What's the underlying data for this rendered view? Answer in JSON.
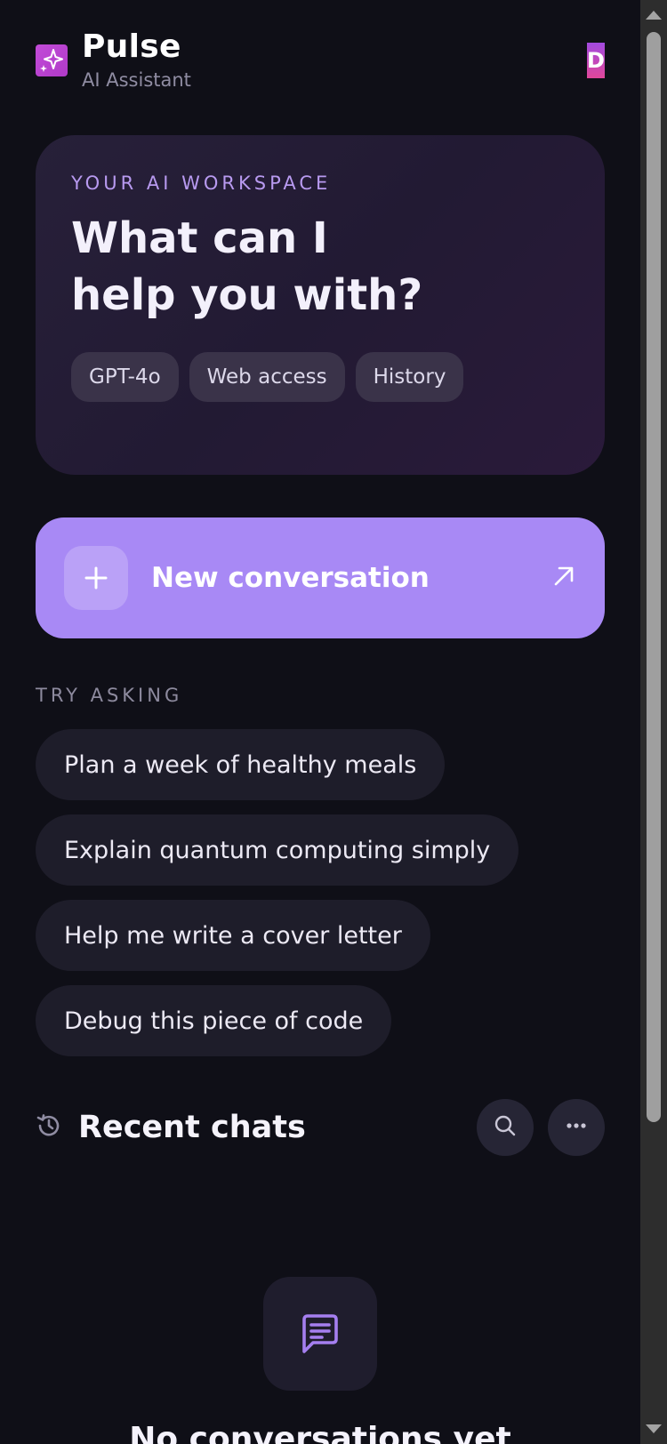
{
  "header": {
    "app_title": "Pulse",
    "app_subtitle": "AI Assistant",
    "logo_icon": "sparkle-icon",
    "avatar_letter": "D"
  },
  "hero": {
    "eyebrow": "YOUR AI WORKSPACE",
    "title": "What can I help you with?",
    "chips": [
      "GPT-4o",
      "Web access",
      "History"
    ]
  },
  "new_conversation": {
    "label": "New conversation",
    "leading_icon": "plus-icon",
    "trailing_icon": "arrow-up-right-icon"
  },
  "suggestions": {
    "label": "TRY ASKING",
    "items": [
      "Plan a week of healthy meals",
      "Explain quantum computing simply",
      "Help me write a cover letter",
      "Debug this piece of code"
    ]
  },
  "recent": {
    "title": "Recent chats",
    "icon": "history-icon",
    "search_icon": "search-icon",
    "more_icon": "more-horizontal-icon",
    "empty_icon": "message-icon",
    "empty_title": "No conversations yet"
  },
  "colors": {
    "background": "#0f0f17",
    "accent": "#a889f5",
    "hero_eyebrow": "#b89af0",
    "logo": "#c24bd8"
  }
}
